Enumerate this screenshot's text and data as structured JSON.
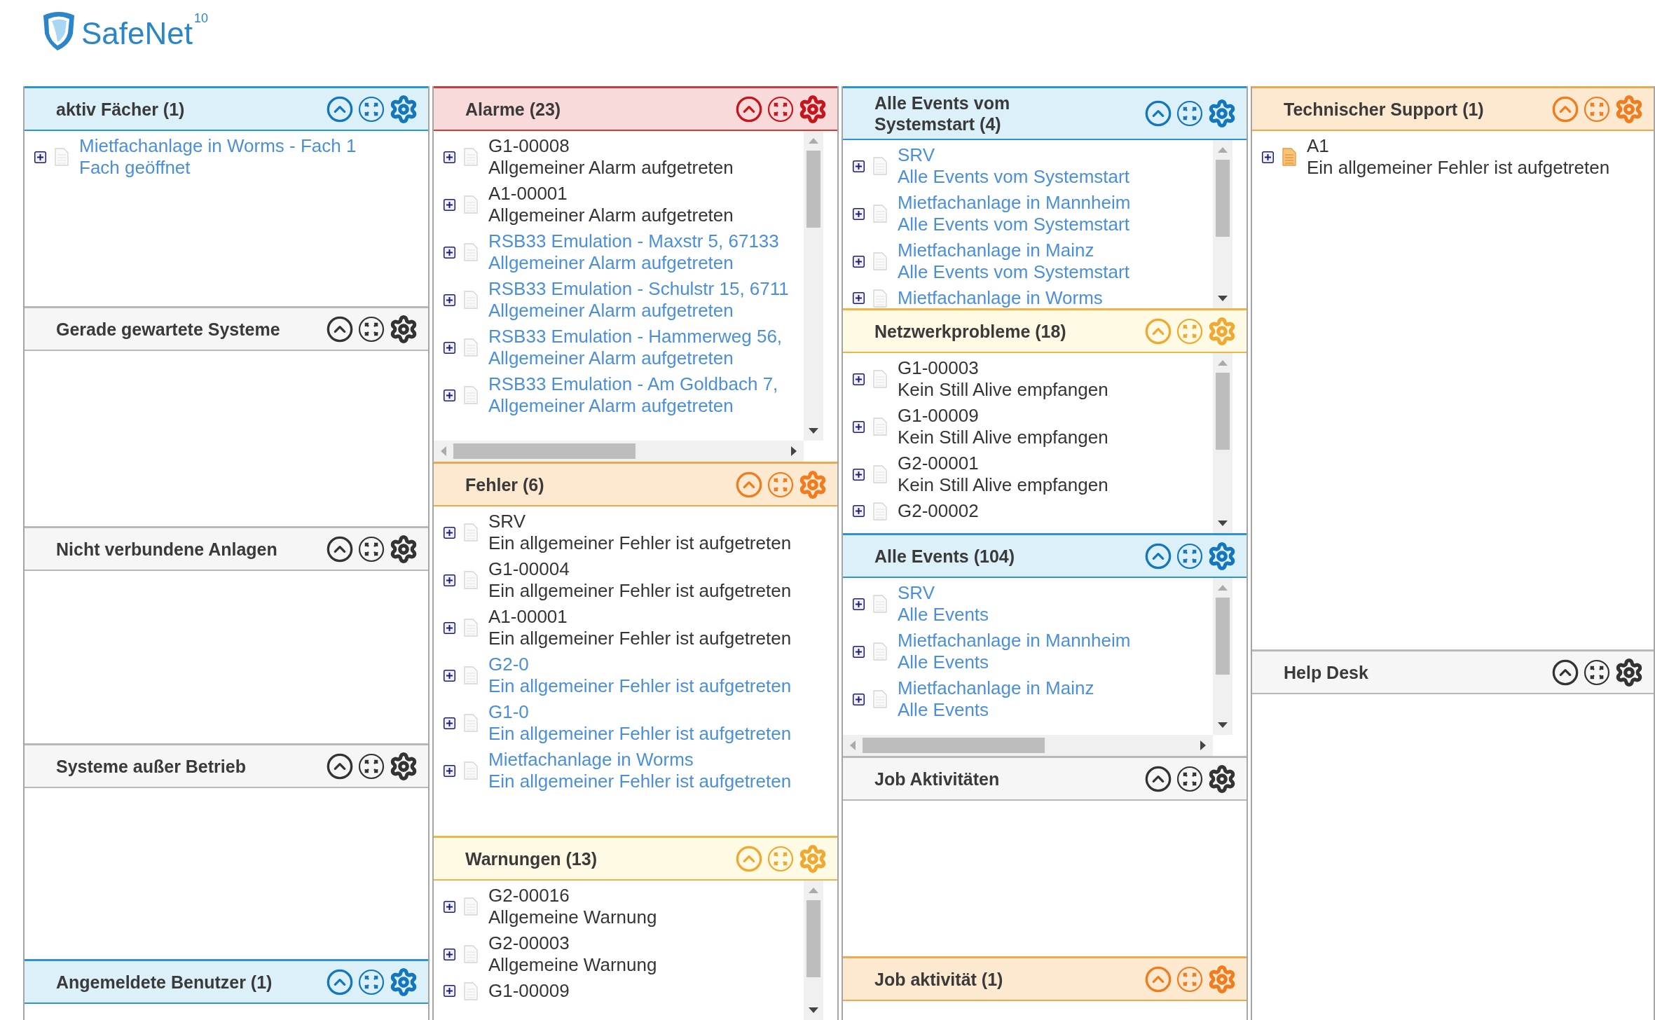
{
  "logo": {
    "name": "SafeNet",
    "version": "10"
  },
  "columns": [
    {
      "panels": [
        {
          "title": "aktiv Fächer (1)",
          "kind": "info",
          "items": [
            {
              "title": "Mietfachanlage in Worms - Fach 1",
              "message": "Fach geöffnet",
              "link": true,
              "flagged": false
            }
          ]
        },
        {
          "title": "Gerade gewartete Systeme",
          "kind": "neutral"
        },
        {
          "title": "Nicht verbundene Anlagen",
          "kind": "neutral"
        },
        {
          "title": "Systeme außer Betrieb",
          "kind": "neutral"
        },
        {
          "title": "Angemeldete Benutzer (1)",
          "kind": "info"
        }
      ]
    },
    {
      "panels": [
        {
          "title": "Alarme (23)",
          "kind": "alarm",
          "scroll_vertical": true,
          "scroll_horizontal": true,
          "items": [
            {
              "title": "G1-00008",
              "message": "Allgemeiner Alarm aufgetreten",
              "link": false,
              "flagged": false
            },
            {
              "title": "A1-00001",
              "message": "Allgemeiner Alarm aufgetreten",
              "link": false,
              "flagged": false
            },
            {
              "title": "RSB33 Emulation - Maxstr 5, 67133",
              "message": "Allgemeiner Alarm aufgetreten",
              "link": true,
              "flagged": false
            },
            {
              "title": "RSB33 Emulation - Schulstr 15, 6711",
              "message": "Allgemeiner Alarm aufgetreten",
              "link": true,
              "flagged": false
            },
            {
              "title": "RSB33 Emulation - Hammerweg 56,",
              "message": "Allgemeiner Alarm aufgetreten",
              "link": true,
              "flagged": false
            },
            {
              "title": "RSB33 Emulation - Am Goldbach 7,",
              "message": "Allgemeiner Alarm aufgetreten",
              "link": true,
              "flagged": false
            }
          ]
        },
        {
          "title": "Fehler (6)",
          "kind": "error",
          "items": [
            {
              "title": "SRV",
              "message": "Ein allgemeiner Fehler ist aufgetreten",
              "link": false,
              "flagged": false
            },
            {
              "title": "G1-00004",
              "message": "Ein allgemeiner Fehler ist aufgetreten",
              "link": false,
              "flagged": false
            },
            {
              "title": "A1-00001",
              "message": "Ein allgemeiner Fehler ist aufgetreten",
              "link": false,
              "flagged": false
            },
            {
              "title": "G2-0",
              "message": "Ein allgemeiner Fehler ist aufgetreten",
              "link": true,
              "flagged": false
            },
            {
              "title": "G1-0",
              "message": "Ein allgemeiner Fehler ist aufgetreten",
              "link": true,
              "flagged": false
            },
            {
              "title": "Mietfachanlage in Worms",
              "message": "Ein allgemeiner Fehler ist aufgetreten",
              "link": true,
              "flagged": false
            }
          ]
        },
        {
          "title": "Warnungen (13)",
          "kind": "warning",
          "scroll_vertical": true,
          "items": [
            {
              "title": "G2-00016",
              "message": "Allgemeine Warnung",
              "link": false,
              "flagged": false
            },
            {
              "title": "G2-00003",
              "message": "Allgemeine Warnung",
              "link": false,
              "flagged": false
            },
            {
              "title": "G1-00009",
              "link": false,
              "flagged": false
            }
          ]
        }
      ]
    },
    {
      "panels": [
        {
          "title": "Alle Events vom Systemstart (4)",
          "kind": "info",
          "scroll_vertical": true,
          "items": [
            {
              "title": "SRV",
              "message": "Alle Events vom Systemstart",
              "link": true,
              "flagged": false
            },
            {
              "title": "Mietfachanlage in Mannheim",
              "message": "Alle Events vom Systemstart",
              "link": true,
              "flagged": false
            },
            {
              "title": "Mietfachanlage in Mainz",
              "message": "Alle Events vom Systemstart",
              "link": true,
              "flagged": false
            },
            {
              "title": "Mietfachanlage in Worms",
              "link": true,
              "flagged": false
            }
          ]
        },
        {
          "title": "Netzwerkprobleme (18)",
          "kind": "warning",
          "scroll_vertical": true,
          "items": [
            {
              "title": "G1-00003",
              "message": "Kein Still Alive empfangen",
              "link": false,
              "flagged": false
            },
            {
              "title": "G1-00009",
              "message": "Kein Still Alive empfangen",
              "link": false,
              "flagged": false
            },
            {
              "title": "G2-00001",
              "message": "Kein Still Alive empfangen",
              "link": false,
              "flagged": false
            },
            {
              "title": "G2-00002",
              "link": false,
              "flagged": false
            }
          ]
        },
        {
          "title": "Alle Events (104)",
          "kind": "info",
          "scroll_vertical": true,
          "scroll_horizontal": true,
          "items": [
            {
              "title": "SRV",
              "message": "Alle Events",
              "link": true,
              "flagged": false
            },
            {
              "title": "Mietfachanlage in Mannheim",
              "message": "Alle Events",
              "link": true,
              "flagged": false
            },
            {
              "title": "Mietfachanlage in Mainz",
              "message": "Alle Events",
              "link": true,
              "flagged": false
            }
          ]
        },
        {
          "title": "Job Aktivitäten",
          "kind": "neutral"
        },
        {
          "title": "Job aktivität (1)",
          "kind": "error"
        }
      ]
    },
    {
      "panels": [
        {
          "title": "Technischer Support (1)",
          "kind": "error",
          "items": [
            {
              "title": "A1",
              "message": "Ein allgemeiner Fehler ist aufgetreten",
              "link": false,
              "flagged": true
            }
          ]
        },
        {
          "title": "Help Desk",
          "kind": "neutral"
        }
      ]
    }
  ]
}
